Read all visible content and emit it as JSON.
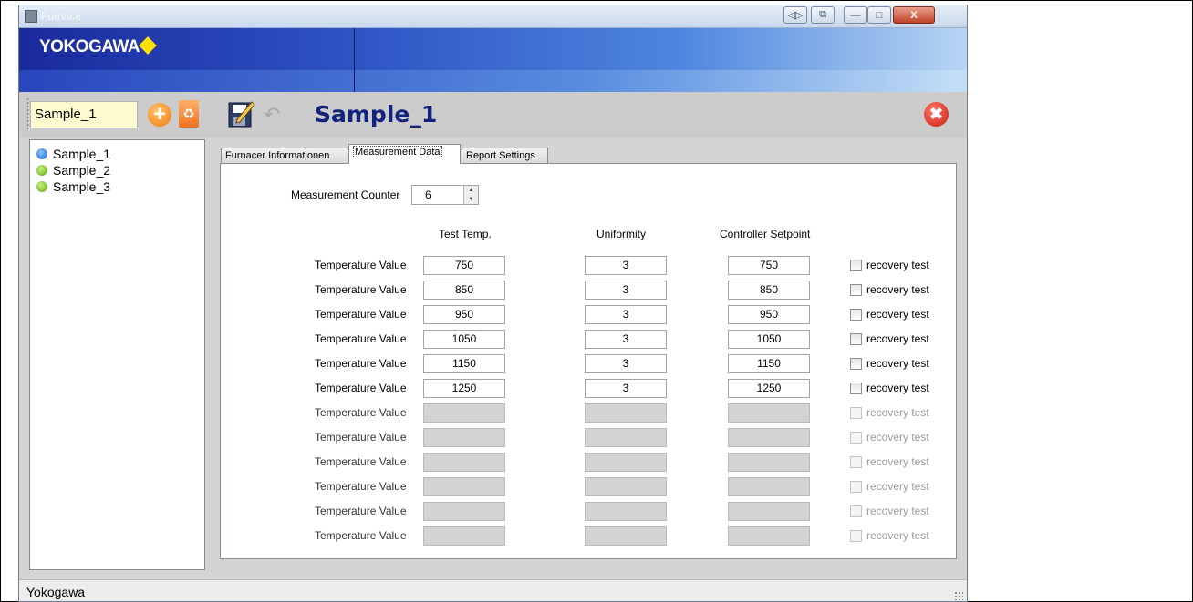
{
  "window": {
    "title": "Furnace",
    "controls": [
      "◁▷",
      "⧉",
      "—",
      "□",
      "X"
    ]
  },
  "banner": {
    "logo": "YOKOGAWA"
  },
  "toolbar": {
    "name_value": "Sample_1",
    "page_title": "Sample_1"
  },
  "tree": {
    "items": [
      {
        "label": "Sample_1",
        "state": "selected"
      },
      {
        "label": "Sample_2",
        "state": "normal"
      },
      {
        "label": "Sample_3",
        "state": "normal"
      }
    ]
  },
  "tabs": [
    {
      "label": "Furnacer Informationen",
      "active": false
    },
    {
      "label": "Measurement Data",
      "active": true
    },
    {
      "label": "Report Settings",
      "active": false
    }
  ],
  "measurement": {
    "counter_label": "Measurement Counter",
    "counter_value": "6",
    "headers": [
      "Test Temp.",
      "Uniformity",
      "Controller Setpoint"
    ],
    "row_label": "Temperature Value",
    "checkbox_label": "recovery test",
    "rows": [
      {
        "test_temp": "750",
        "uniformity": "3",
        "setpoint": "750",
        "enabled": true
      },
      {
        "test_temp": "850",
        "uniformity": "3",
        "setpoint": "850",
        "enabled": true
      },
      {
        "test_temp": "950",
        "uniformity": "3",
        "setpoint": "950",
        "enabled": true
      },
      {
        "test_temp": "1050",
        "uniformity": "3",
        "setpoint": "1050",
        "enabled": true
      },
      {
        "test_temp": "1150",
        "uniformity": "3",
        "setpoint": "1150",
        "enabled": true
      },
      {
        "test_temp": "1250",
        "uniformity": "3",
        "setpoint": "1250",
        "enabled": true
      },
      {
        "test_temp": "",
        "uniformity": "",
        "setpoint": "",
        "enabled": false
      },
      {
        "test_temp": "",
        "uniformity": "",
        "setpoint": "",
        "enabled": false
      },
      {
        "test_temp": "",
        "uniformity": "",
        "setpoint": "",
        "enabled": false
      },
      {
        "test_temp": "",
        "uniformity": "",
        "setpoint": "",
        "enabled": false
      },
      {
        "test_temp": "",
        "uniformity": "",
        "setpoint": "",
        "enabled": false
      },
      {
        "test_temp": "",
        "uniformity": "",
        "setpoint": "",
        "enabled": false
      }
    ]
  },
  "status": {
    "text": "Yokogawa"
  }
}
